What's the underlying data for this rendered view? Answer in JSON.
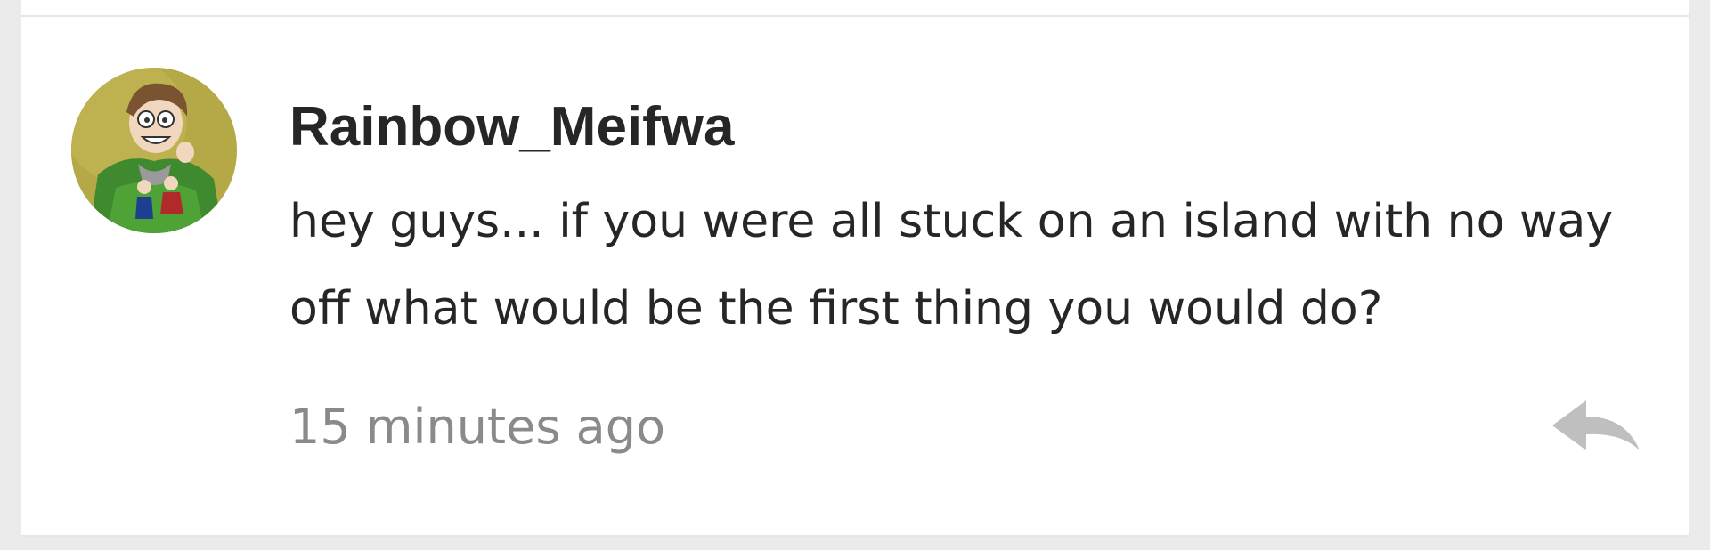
{
  "comment": {
    "username": "Rainbow_Meifwa",
    "message": "hey guys... if you were all stuck on an island with no way off what would be the first thing you would do?",
    "timestamp": "15 minutes ago",
    "avatar_icon": "avatar-image",
    "reply_icon": "reply-arrow-icon"
  },
  "colors": {
    "page_bg": "#ebebeb",
    "card_bg": "#ffffff",
    "text": "#262626",
    "muted": "#8a8a8a",
    "icon": "#bfbfbf"
  }
}
